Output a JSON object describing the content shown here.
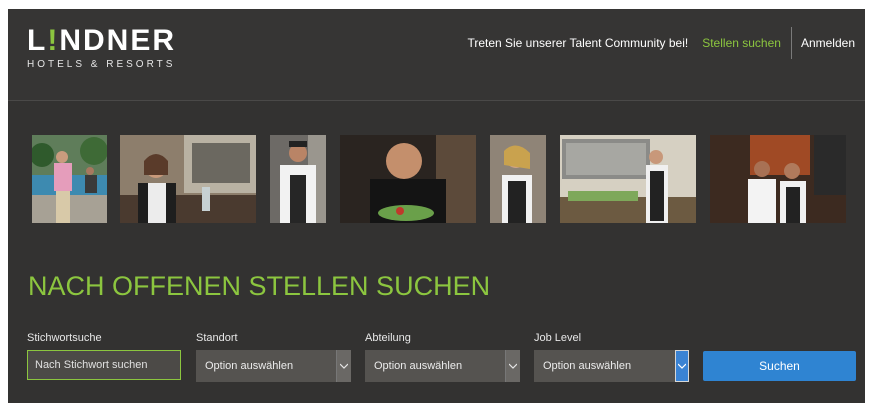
{
  "brand": {
    "name_prefix": "L",
    "name_accent": "!",
    "name_suffix": "NDNER",
    "tagline": "HOTELS & RESORTS"
  },
  "nav": {
    "talent_community": "Treten Sie unserer Talent Community bei!",
    "job_search": "Stellen suchen",
    "login": "Anmelden"
  },
  "search": {
    "title": "NACH OFFENEN STELLEN SUCHEN",
    "keyword_label": "Stichwortsuche",
    "keyword_placeholder": "Nach Stichwort suchen",
    "location_label": "Standort",
    "location_value": "Option auswählen",
    "department_label": "Abteilung",
    "department_value": "Option auswählen",
    "joblevel_label": "Job Level",
    "joblevel_value": "Option auswählen",
    "submit_label": "Suchen"
  },
  "colors": {
    "accent_green": "#8cc63f",
    "button_blue": "#2f84d2",
    "background": "#333231"
  }
}
